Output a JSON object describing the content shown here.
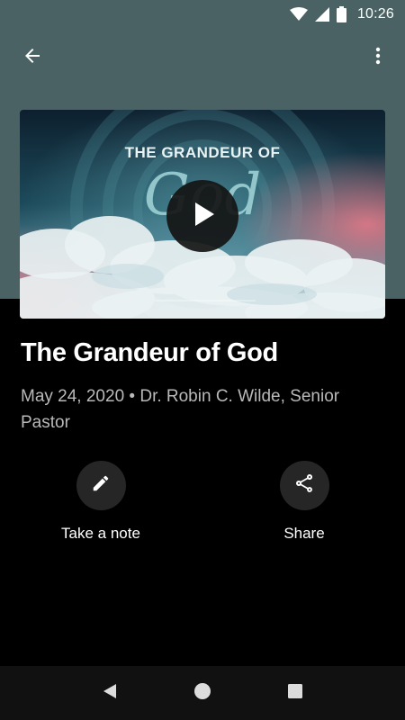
{
  "status_bar": {
    "time": "10:26",
    "icons": [
      "wifi-icon",
      "cell-signal-icon",
      "battery-icon"
    ]
  },
  "toolbar": {
    "back_icon": "arrow-back-icon",
    "menu_icon": "more-vert-icon"
  },
  "media": {
    "artwork_title": "THE GRANDEUR OF",
    "artwork_word": "God",
    "play_icon": "play-icon"
  },
  "sermon": {
    "title": "The Grandeur of God",
    "meta": "May 24, 2020 • Dr. Robin C. Wilde, Senior Pastor"
  },
  "actions": [
    {
      "label": "Take a note",
      "icon": "pencil-icon"
    },
    {
      "label": "Share",
      "icon": "share-icon"
    }
  ],
  "nav_bar": {
    "icons": [
      "nav-back-icon",
      "nav-home-icon",
      "nav-recents-icon"
    ]
  },
  "colors": {
    "header_bg": "#4a6263",
    "background": "#000000",
    "action_circle": "#262626",
    "meta_text": "#b9b9b9",
    "nav_bg": "#111111"
  }
}
